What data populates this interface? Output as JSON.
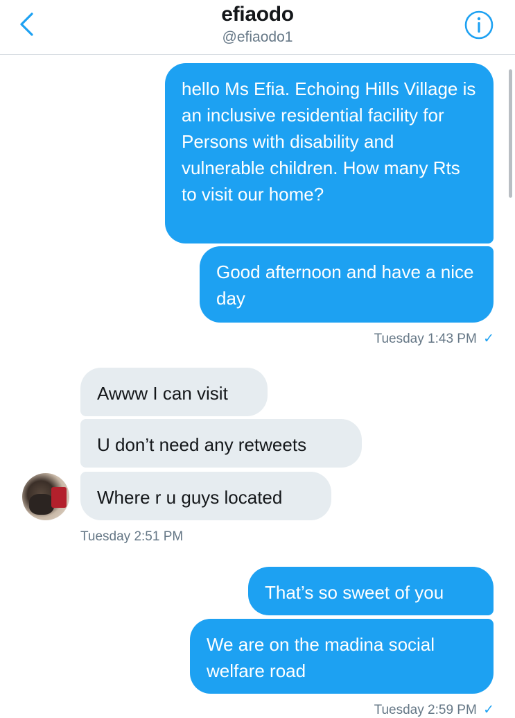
{
  "header": {
    "title": "efiaodo",
    "handle": "@efiaodo1",
    "back_icon": "chevron-left-icon",
    "info_icon": "info-icon"
  },
  "colors": {
    "accent": "#1da1f2",
    "incoming_bubble": "#e6ecf0",
    "meta_text": "#657786"
  },
  "messages": [
    {
      "from": "me",
      "text": "hello Ms Efia. Echoing Hills Village is an inclusive residential facility for Persons with disability and vulnerable children. How many Rts to visit our home?"
    },
    {
      "from": "me",
      "text": "Good afternoon and have a nice day"
    },
    {
      "from": "them",
      "text": "Awww I can visit"
    },
    {
      "from": "them",
      "text": "U don’t need any retweets"
    },
    {
      "from": "them",
      "text": "Where r u guys located"
    },
    {
      "from": "me",
      "text": "That’s so sweet of you"
    },
    {
      "from": "me",
      "text": "We are on the madina social welfare road"
    }
  ],
  "timestamps": {
    "group1": "Tuesday 1:43 PM",
    "group2": "Tuesday 2:51 PM",
    "group3": "Tuesday 2:59 PM"
  },
  "read_check": "✓"
}
